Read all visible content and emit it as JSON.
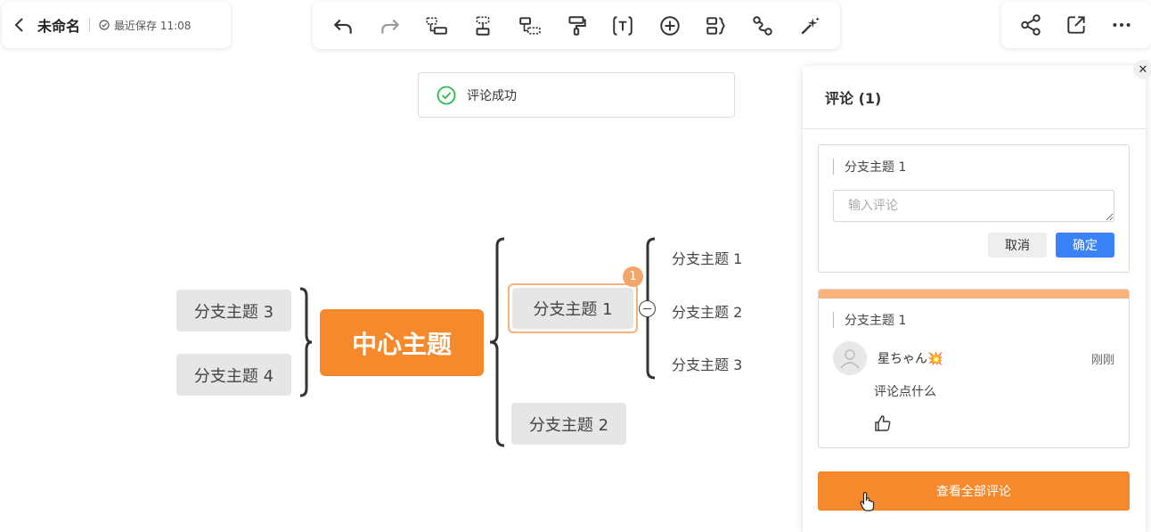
{
  "header": {
    "doc_title": "未命名",
    "save_status": "最近保存 11:08"
  },
  "toast": {
    "message": "评论成功"
  },
  "mindmap": {
    "center": "中心主题",
    "left_branches": [
      "分支主题 3",
      "分支主题 4"
    ],
    "right_branches": [
      "分支主题 1",
      "分支主题 2"
    ],
    "sub_branches": [
      "分支主题 1",
      "分支主题 2",
      "分支主题 3"
    ],
    "comment_badge": "1"
  },
  "comments_panel": {
    "title": "评论 (1)",
    "compose": {
      "topic": "分支主题 1",
      "placeholder": "输入评论",
      "cancel_label": "取消",
      "confirm_label": "确定"
    },
    "comment": {
      "topic": "分支主题 1",
      "author": "星ちゃん💥",
      "time": "刚刚",
      "text": "评论点什么"
    },
    "view_all_label": "查看全部评论"
  },
  "colors": {
    "accent_orange": "#f5892c",
    "confirm_blue": "#3b82f6",
    "success_green": "#2db84d"
  }
}
